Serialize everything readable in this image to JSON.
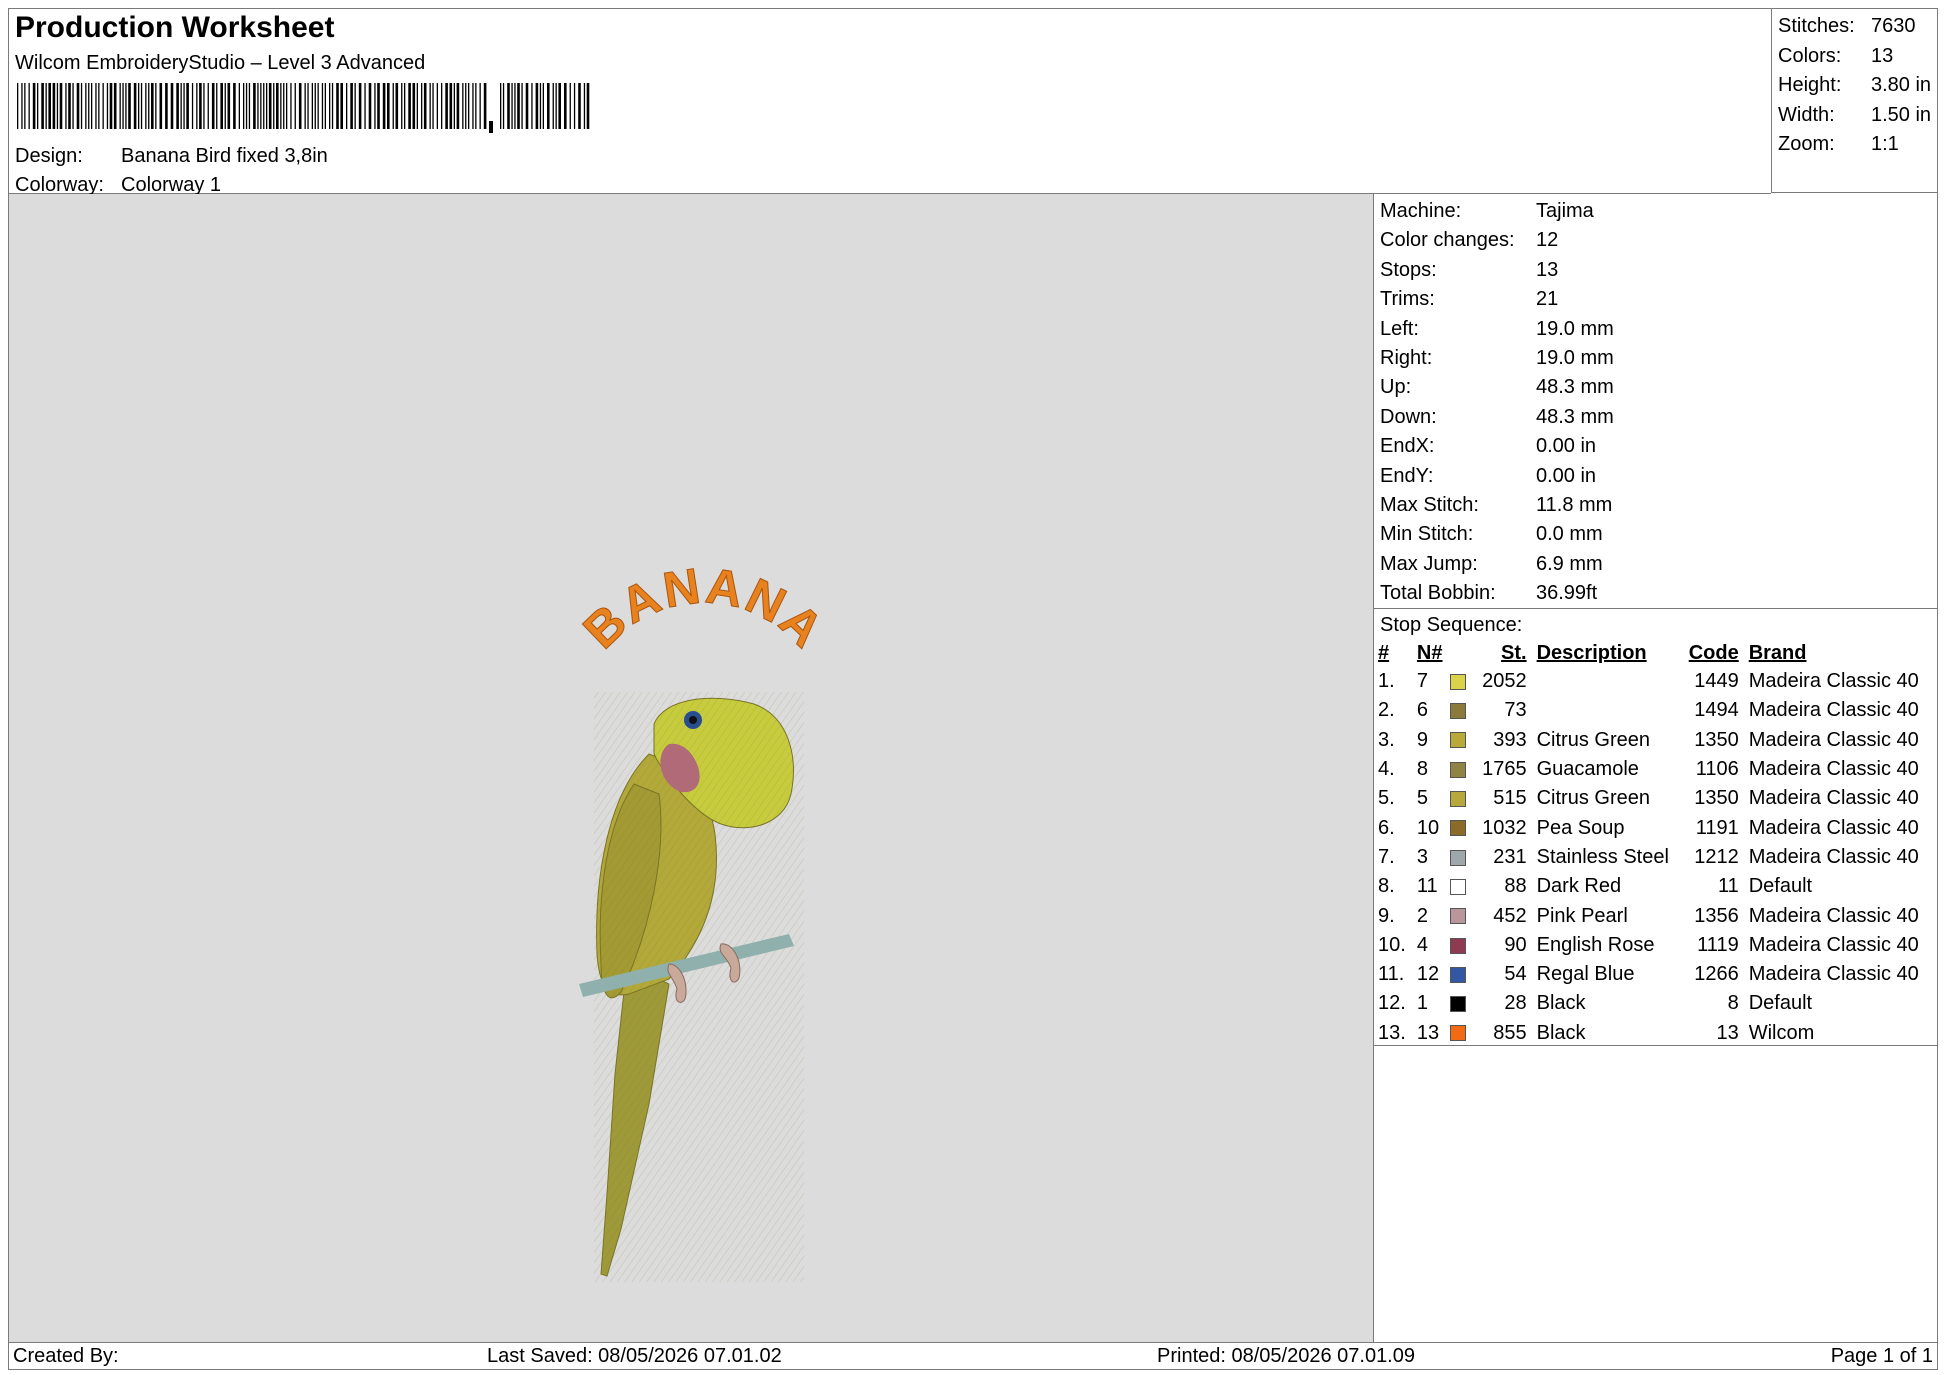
{
  "header": {
    "title": "Production Worksheet",
    "software": "Wilcom EmbroideryStudio – Level 3 Advanced",
    "design_label": "Design:",
    "design_value": "Banana Bird fixed 3,8in",
    "colorway_label": "Colorway:",
    "colorway_value": "Colorway 1"
  },
  "summary": [
    {
      "label": "Stitches:",
      "value": "7630"
    },
    {
      "label": "Colors:",
      "value": "13"
    },
    {
      "label": "Height:",
      "value": "3.80 in"
    },
    {
      "label": "Width:",
      "value": "1.50 in"
    },
    {
      "label": "Zoom:",
      "value": "1:1"
    }
  ],
  "design": {
    "text": "BANANA",
    "text_color": "#e8821e",
    "body_color": "#b3a93a",
    "head_color": "#c7cc3e",
    "perch_color": "#8fb0ad",
    "beak_color": "#b06a78",
    "eye_color": "#2a4d8f"
  },
  "machine_info": [
    {
      "label": "Machine:",
      "value": "Tajima"
    },
    {
      "label": "Color changes:",
      "value": "12"
    },
    {
      "label": "Stops:",
      "value": "13"
    },
    {
      "label": "Trims:",
      "value": "21"
    },
    {
      "label": "Left:",
      "value": "19.0 mm"
    },
    {
      "label": "Right:",
      "value": "19.0 mm"
    },
    {
      "label": "Up:",
      "value": "48.3 mm"
    },
    {
      "label": "Down:",
      "value": "48.3 mm"
    },
    {
      "label": "EndX:",
      "value": "0.00 in"
    },
    {
      "label": "EndY:",
      "value": "0.00 in"
    },
    {
      "label": "Max Stitch:",
      "value": "11.8 mm"
    },
    {
      "label": "Min Stitch:",
      "value": "0.0 mm"
    },
    {
      "label": "Max Jump:",
      "value": "6.9 mm"
    },
    {
      "label": "Total Bobbin:",
      "value": "36.99ft"
    }
  ],
  "stop_sequence": {
    "title": "Stop Sequence:",
    "columns": {
      "num": "#",
      "n": "N#",
      "st": "St.",
      "desc": "Description",
      "code": "Code",
      "brand": "Brand"
    },
    "rows": [
      {
        "num": "1.",
        "n": "7",
        "color": "#d9d24a",
        "st": "2052",
        "desc": "",
        "code": "1449",
        "brand": "Madeira Classic 40"
      },
      {
        "num": "2.",
        "n": "6",
        "color": "#8a7a3c",
        "st": "73",
        "desc": "",
        "code": "1494",
        "brand": "Madeira Classic 40"
      },
      {
        "num": "3.",
        "n": "9",
        "color": "#b9a83a",
        "st": "393",
        "desc": "Citrus Green",
        "code": "1350",
        "brand": "Madeira Classic 40"
      },
      {
        "num": "4.",
        "n": "8",
        "color": "#8f8444",
        "st": "1765",
        "desc": "Guacamole",
        "code": "1106",
        "brand": "Madeira Classic 40"
      },
      {
        "num": "5.",
        "n": "5",
        "color": "#b7a83e",
        "st": "515",
        "desc": "Citrus Green",
        "code": "1350",
        "brand": "Madeira Classic 40"
      },
      {
        "num": "6.",
        "n": "10",
        "color": "#8c6a28",
        "st": "1032",
        "desc": "Pea Soup",
        "code": "1191",
        "brand": "Madeira Classic 40"
      },
      {
        "num": "7.",
        "n": "3",
        "color": "#9ea8ab",
        "st": "231",
        "desc": "Stainless Steel",
        "code": "1212",
        "brand": "Madeira Classic 40"
      },
      {
        "num": "8.",
        "n": "11",
        "color": "#ffffff",
        "st": "88",
        "desc": "Dark Red",
        "code": "11",
        "brand": "Default"
      },
      {
        "num": "9.",
        "n": "2",
        "color": "#b9959c",
        "st": "452",
        "desc": "Pink Pearl",
        "code": "1356",
        "brand": "Madeira Classic 40"
      },
      {
        "num": "10.",
        "n": "4",
        "color": "#8e3a50",
        "st": "90",
        "desc": "English Rose",
        "code": "1119",
        "brand": "Madeira Classic 40"
      },
      {
        "num": "11.",
        "n": "12",
        "color": "#3457a3",
        "st": "54",
        "desc": "Regal Blue",
        "code": "1266",
        "brand": "Madeira Classic 40"
      },
      {
        "num": "12.",
        "n": "1",
        "color": "#000000",
        "st": "28",
        "desc": "Black",
        "code": "8",
        "brand": "Default"
      },
      {
        "num": "13.",
        "n": "13",
        "color": "#f26a12",
        "st": "855",
        "desc": "Black",
        "code": "13",
        "brand": "Wilcom"
      }
    ]
  },
  "footer": {
    "created_by": "Created By:",
    "last_saved": "Last Saved: 08/05/2026 07.01.02",
    "printed": "Printed: 08/05/2026 07.01.09",
    "page": "Page 1 of 1"
  }
}
